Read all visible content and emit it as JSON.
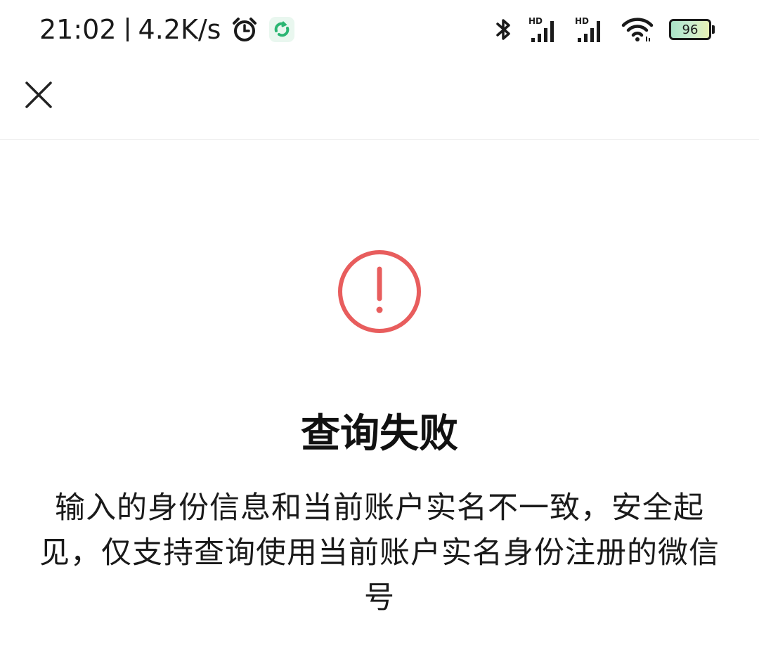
{
  "status_bar": {
    "time": "21:02",
    "net_speed": "4.2K/s",
    "battery_level": "96",
    "icons": [
      "alarm-icon",
      "app-notification-icon",
      "bluetooth-icon",
      "hd-signal-icon",
      "hd-signal-icon",
      "wifi-icon",
      "battery-icon"
    ],
    "notification_icon_color": "#2bb673"
  },
  "header": {
    "close_icon": "close-icon"
  },
  "result": {
    "icon": "warning-circle-icon",
    "icon_color": "#e85d5d",
    "title": "查询失败",
    "message": "输入的身份信息和当前账户实名不一致，安全起见，仅支持查询使用当前账户实名身份注册的微信号"
  }
}
